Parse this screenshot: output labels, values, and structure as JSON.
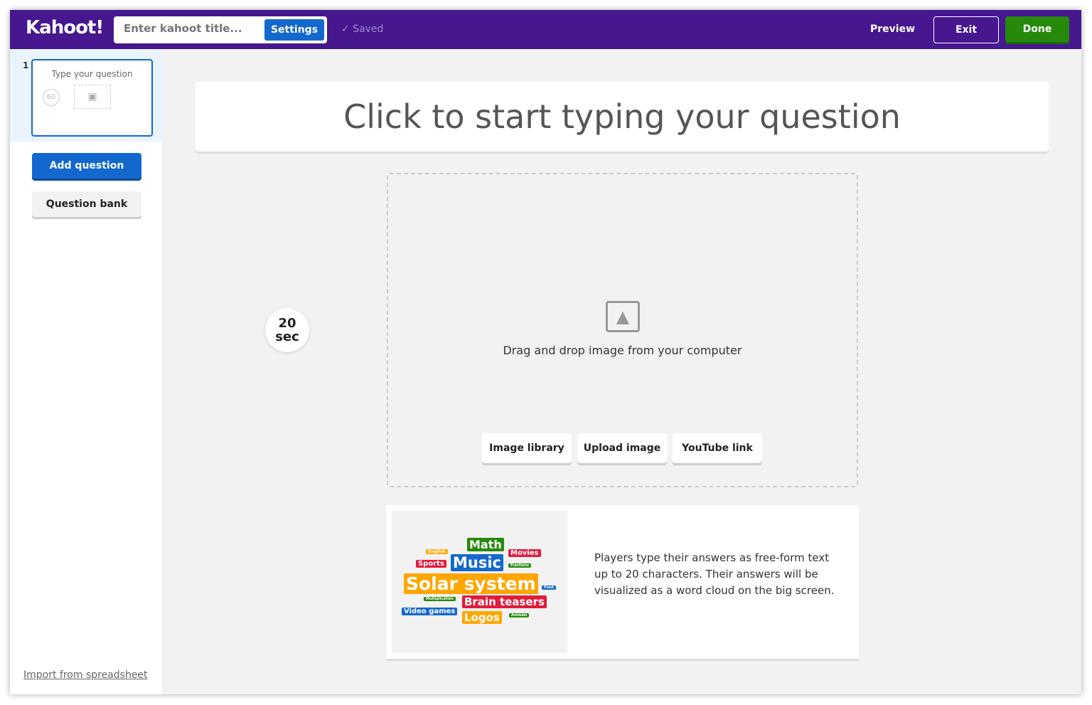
{
  "header": {
    "logo": "Kahoot!",
    "title_placeholder": "Enter kahoot title...",
    "settings": "Settings",
    "saved": "✓  Saved",
    "preview": "Preview",
    "exit": "Exit",
    "done": "Done"
  },
  "sidebar": {
    "items": [
      {
        "number": "1",
        "title": "Type your question",
        "time": "60"
      }
    ],
    "add_question": "Add question",
    "question_bank": "Question bank",
    "import": "Import from spreadsheet"
  },
  "main": {
    "question_placeholder": "Click to start typing your question",
    "timer": {
      "value": "20",
      "unit": "sec"
    },
    "media": {
      "drag_text": "Drag and drop image from your computer",
      "buttons": [
        "Image library",
        "Upload image",
        "YouTube link"
      ]
    },
    "info": {
      "description": "Players type their answers as free-form text up to 20 characters. Their answers will be visualized as a word cloud on the big screen.",
      "word_cloud": [
        "Math",
        "English",
        "Movies",
        "Sports",
        "Music",
        "Fractions",
        "Solar system",
        "Food",
        "Multiplication",
        "Brain teasers",
        "Video games",
        "Logos",
        "Animals"
      ]
    }
  },
  "colors": {
    "header": "#46178f",
    "primary": "#1368ce",
    "done": "#26890c",
    "green": "#26890c",
    "red": "#e21b3c",
    "orange": "#ffa602",
    "blue": "#1368ce"
  }
}
